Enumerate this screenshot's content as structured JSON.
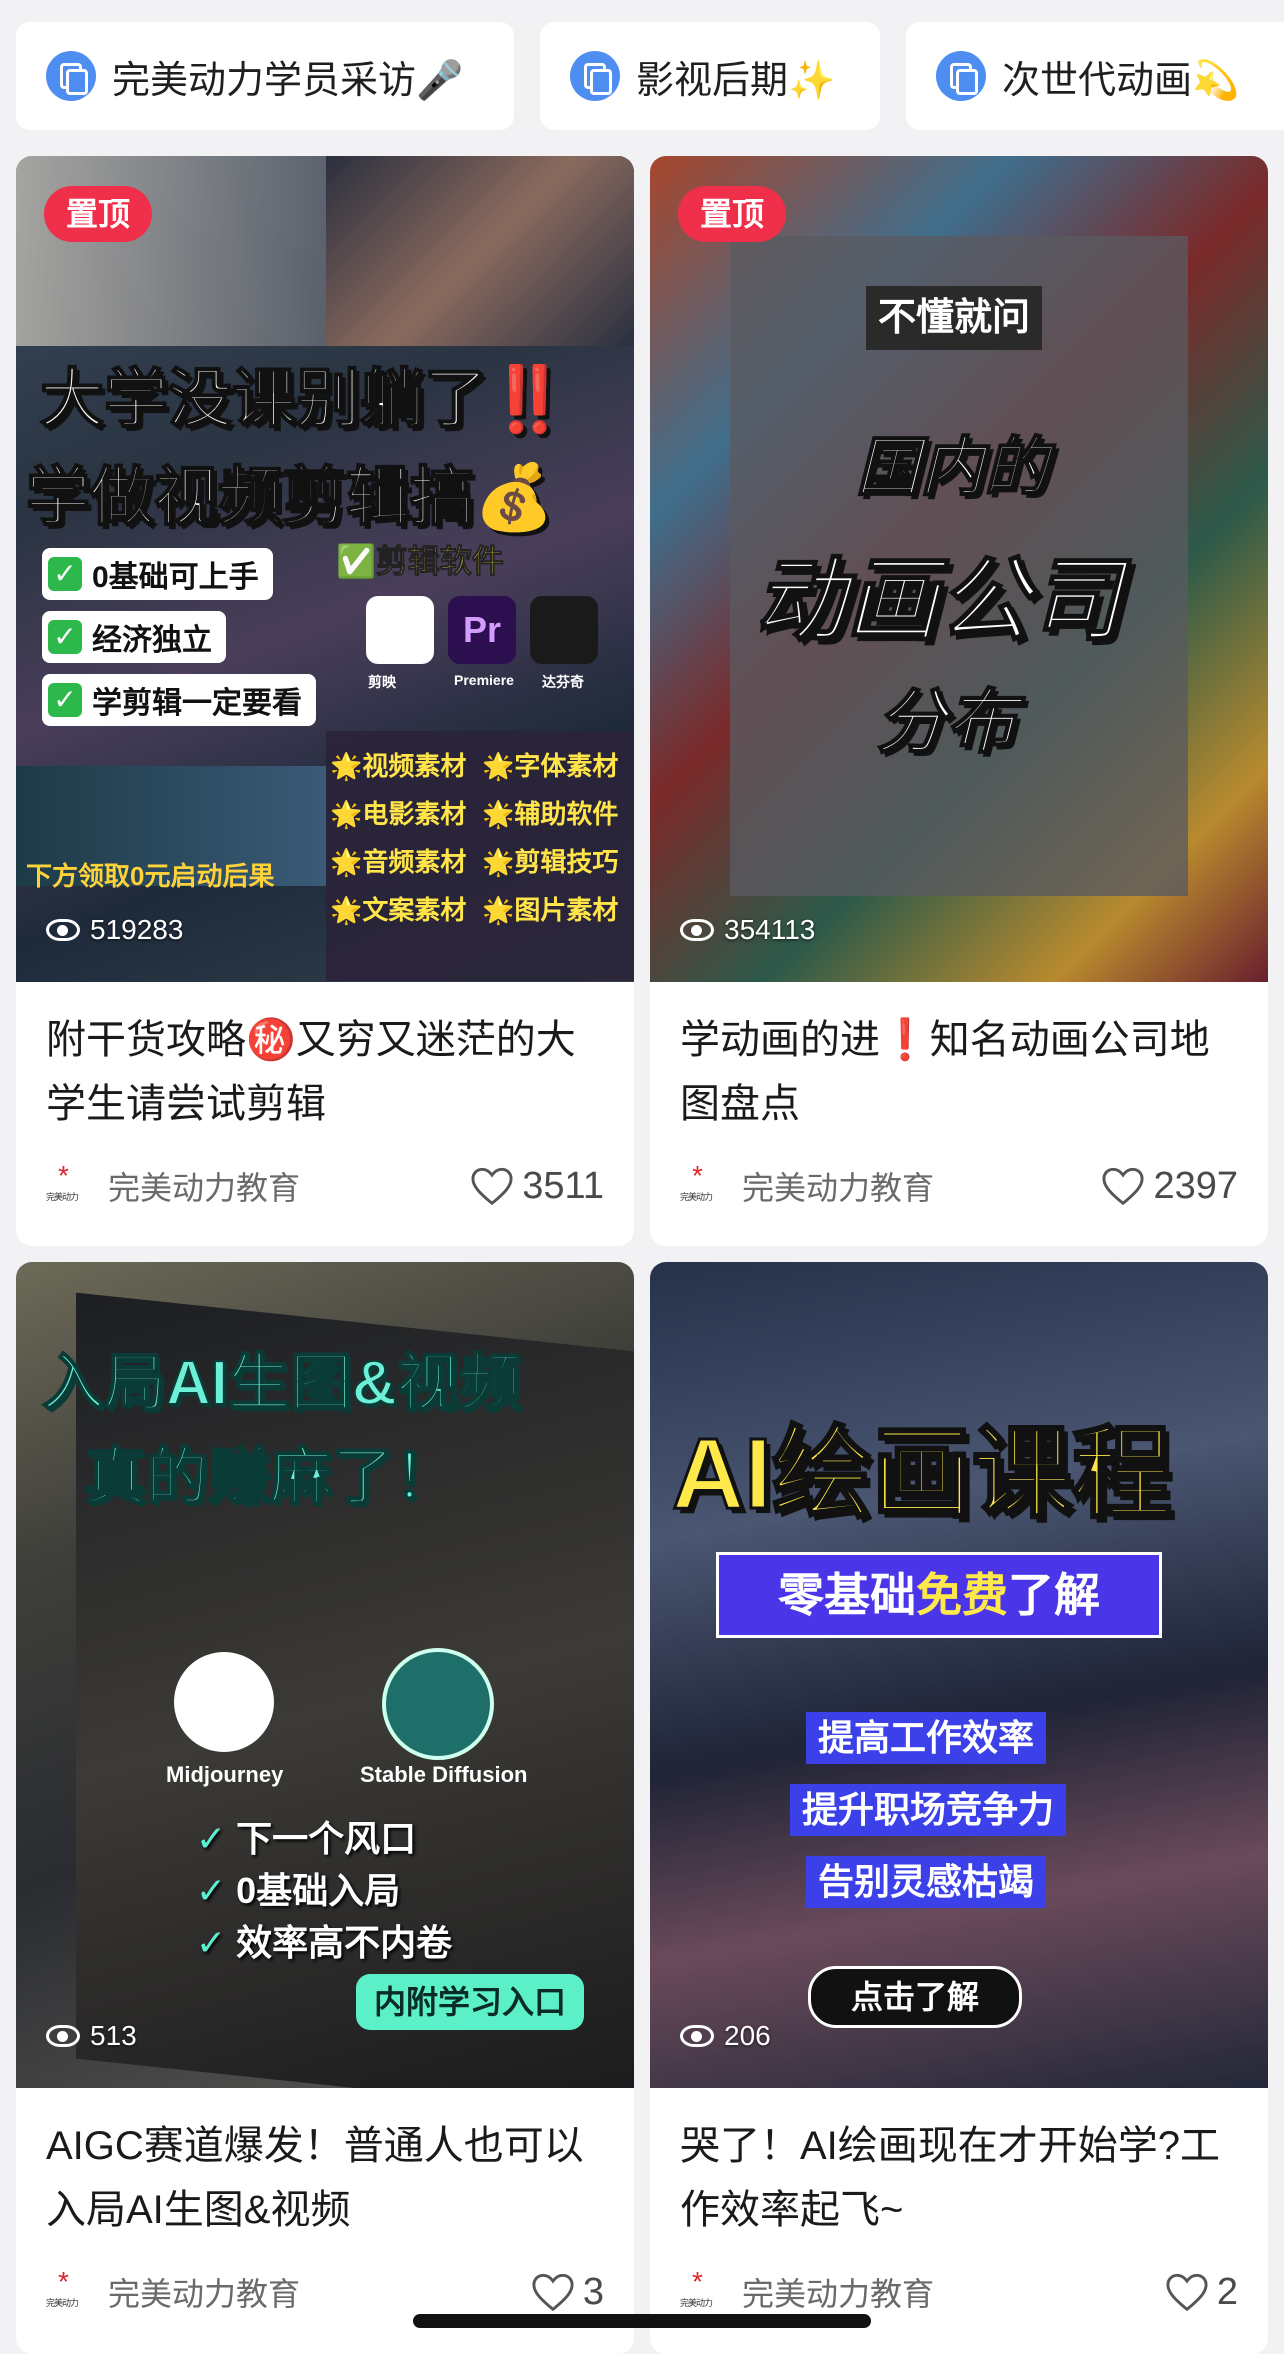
{
  "collections": [
    {
      "label": "完美动力学员采访🎤"
    },
    {
      "label": "影视后期✨"
    },
    {
      "label": "次世代动画💫"
    }
  ],
  "cards": [
    {
      "pinned_label": "置顶",
      "views": "519283",
      "title": "附干货攻略㊙️又穷又迷茫的大学生请尝试剪辑",
      "author": "完美动力教育",
      "likes": "3511",
      "art": {
        "line1": "大学没课别躺了‼️",
        "line2": "学做视频剪辑搞💰",
        "checks": [
          "0基础可上手",
          "经济独立",
          "学剪辑一定要看"
        ],
        "tag_software": "✅剪辑软件",
        "apps": [
          "剪映",
          "Premiere",
          "达芬奇"
        ],
        "materials": [
          "🌟视频素材",
          "🌟字体素材",
          "🌟电影素材",
          "🌟辅助软件",
          "🌟音频素材",
          "🌟剪辑技巧",
          "🌟文案素材",
          "🌟图片素材"
        ],
        "bottom_note": "下方领取0元启动后果"
      }
    },
    {
      "pinned_label": "置顶",
      "views": "354113",
      "title": "学动画的进❗️知名动画公司地图盘点",
      "author": "完美动力教育",
      "likes": "2397",
      "art": {
        "box": "不懂就问",
        "line1": "国内的",
        "line2": "动画公司",
        "line3": "分布"
      }
    },
    {
      "pinned_label": "",
      "views": "513",
      "title": "AIGC赛道爆发！普通人也可以入局AI生图&视频",
      "author": "完美动力教育",
      "likes": "3",
      "art": {
        "line1": "入局AI生图&视频",
        "line2": "真的赚麻了！",
        "logo1": "Midjourney",
        "logo2": "Stable Diffusion",
        "checks": [
          "下一个风口",
          "0基础入局",
          "效率高不内卷"
        ],
        "cta": "内附学习入口"
      }
    },
    {
      "pinned_label": "",
      "views": "206",
      "title": "哭了！AI绘画现在才开始学?工作效率起飞~",
      "author": "完美动力教育",
      "likes": "2",
      "art": {
        "line1": "AI绘画课程",
        "banner_a": "零基础",
        "banner_b": "免费",
        "banner_c": "了解",
        "points": [
          "提高工作效率",
          "提升职场竞争力",
          "告别灵感枯竭"
        ],
        "cta": "点击了解"
      }
    }
  ],
  "colors": {
    "pin": "#f0304a",
    "chip_icon": "#4d8ef0",
    "logo_red": "#e0252b"
  }
}
